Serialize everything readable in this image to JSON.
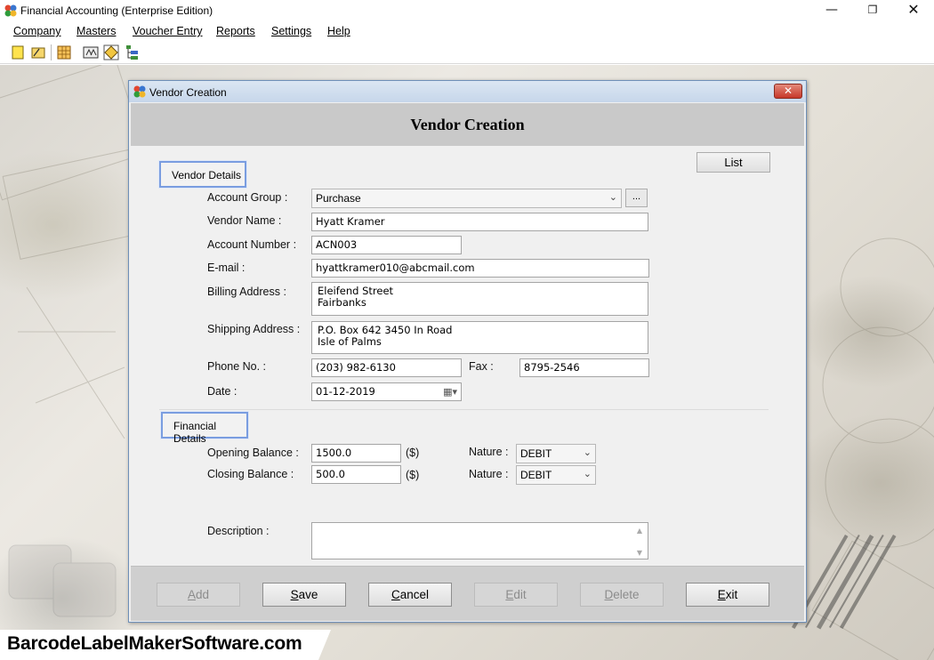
{
  "app": {
    "title": "Financial Accounting (Enterprise Edition)",
    "window_controls": {
      "minimize": "—",
      "maximize": "❐",
      "close": "✕"
    }
  },
  "menu": [
    "Company",
    "Masters",
    "Voucher Entry",
    "Reports",
    "Settings",
    "Help"
  ],
  "toolbar_icons": [
    "new-document-icon",
    "open-folder-icon",
    "grid-table-icon",
    "balance-scale-icon",
    "diamond-icon",
    "tree-icon"
  ],
  "dialog": {
    "title": "Vendor Creation",
    "heading": "Vendor Creation",
    "close_symbol": "✕",
    "list_button": "List",
    "vendor_section": "Vendor Details",
    "financial_section": "Financial Details",
    "fields": {
      "account_group": {
        "label": "Account Group :",
        "value": "Purchase",
        "browse": "..."
      },
      "vendor_name": {
        "label": "Vendor Name :",
        "value": "Hyatt Kramer"
      },
      "account_number": {
        "label": "Account Number :",
        "value": "ACN003"
      },
      "email": {
        "label": "E-mail :",
        "value": "hyattkramer010@abcmail.com"
      },
      "billing_address": {
        "label": "Billing Address :",
        "lines": [
          "Eleifend Street",
          "Fairbanks"
        ]
      },
      "shipping_address": {
        "label": "Shipping Address :",
        "lines": [
          "P.O. Box 642 3450 In Road",
          "Isle of Palms"
        ]
      },
      "phone": {
        "label": "Phone No. :",
        "value": "(203) 982-6130"
      },
      "fax": {
        "label": "Fax :",
        "value": "8795-2546"
      },
      "date": {
        "label": "Date :",
        "value": "01-12-2019"
      },
      "opening_balance": {
        "label": "Opening Balance :",
        "value": "1500.0",
        "unit": "($)",
        "nature_label": "Nature :",
        "nature": "DEBIT"
      },
      "closing_balance": {
        "label": "Closing Balance :",
        "value": "500.0",
        "unit": "($)",
        "nature_label": "Nature :",
        "nature": "DEBIT"
      },
      "description": {
        "label": "Description :",
        "value": ""
      }
    },
    "buttons": [
      {
        "label": "Add",
        "underline": "A",
        "rest": "dd",
        "enabled": false
      },
      {
        "label": "Save",
        "underline": "S",
        "rest": "ave",
        "enabled": true
      },
      {
        "label": "Cancel",
        "underline": "C",
        "rest": "ancel",
        "enabled": true
      },
      {
        "label": "Edit",
        "underline": "E",
        "rest": "dit",
        "enabled": false
      },
      {
        "label": "Delete",
        "underline": "D",
        "rest": "elete",
        "enabled": false
      },
      {
        "label": "Exit",
        "underline": "E",
        "rest": "xit",
        "enabled": true
      }
    ]
  },
  "watermark": "BarcodeLabelMakerSoftware.com",
  "colors": {
    "dialog_border": "#6e8fb8",
    "section_border": "#7a9de0",
    "close_red": "#c6372a",
    "header_gray": "#c9c9c9"
  }
}
